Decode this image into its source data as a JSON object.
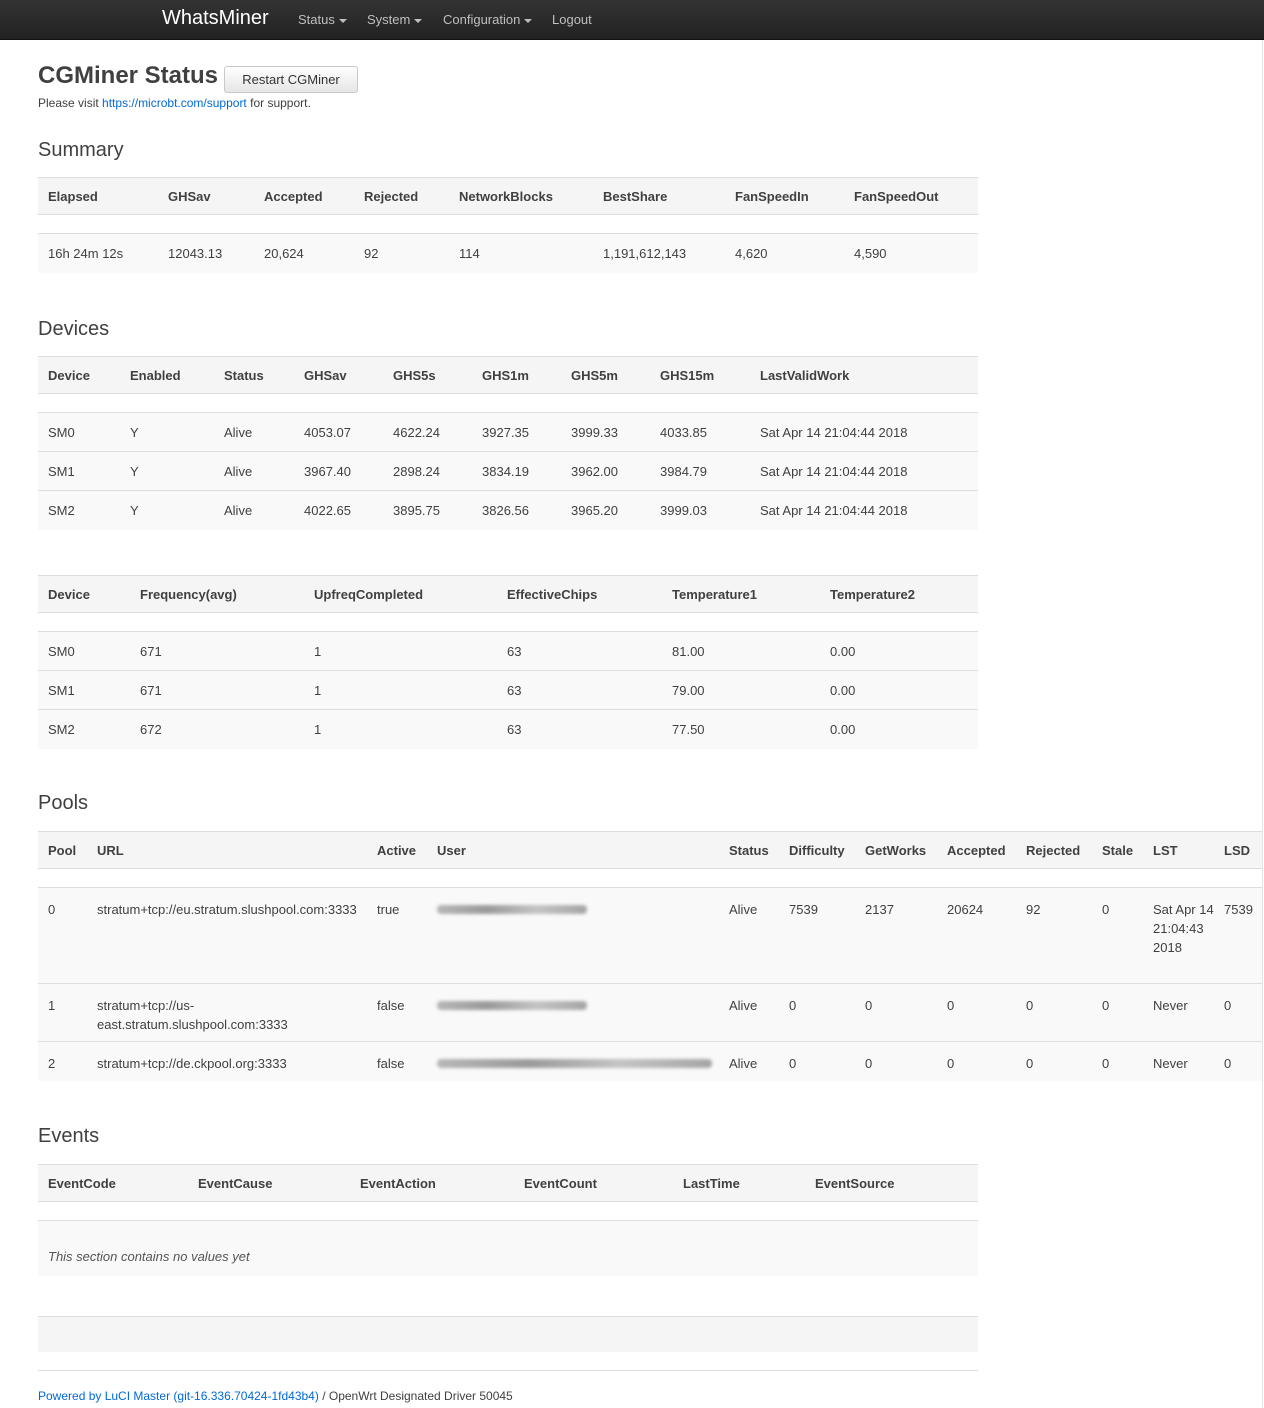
{
  "nav": {
    "brand": "WhatsMiner",
    "items": [
      {
        "label": "Status",
        "dropdown": true
      },
      {
        "label": "System",
        "dropdown": true
      },
      {
        "label": "Configuration",
        "dropdown": true
      },
      {
        "label": "Logout",
        "dropdown": false
      }
    ]
  },
  "header": {
    "title": "CGMiner Status",
    "restart_label": "Restart CGMiner",
    "support_prefix": "Please visit",
    "support_link": "https://microbt.com/support",
    "support_suffix": "for support."
  },
  "summary": {
    "title": "Summary",
    "columns": [
      "Elapsed",
      "GHSav",
      "Accepted",
      "Rejected",
      "NetworkBlocks",
      "BestShare",
      "FanSpeedIn",
      "FanSpeedOut"
    ],
    "rows": [
      [
        "16h 24m 12s",
        "12043.13",
        "20,624",
        "92",
        "114",
        "1,191,612,143",
        "4,620",
        "4,590"
      ]
    ]
  },
  "devices": {
    "title": "Devices",
    "columns": [
      "Device",
      "Enabled",
      "Status",
      "GHSav",
      "GHS5s",
      "GHS1m",
      "GHS5m",
      "GHS15m",
      "LastValidWork"
    ],
    "rows": [
      [
        "SM0",
        "Y",
        "Alive",
        "4053.07",
        "4622.24",
        "3927.35",
        "3999.33",
        "4033.85",
        "Sat Apr 14 21:04:44 2018"
      ],
      [
        "SM1",
        "Y",
        "Alive",
        "3967.40",
        "2898.24",
        "3834.19",
        "3962.00",
        "3984.79",
        "Sat Apr 14 21:04:44 2018"
      ],
      [
        "SM2",
        "Y",
        "Alive",
        "4022.65",
        "3895.75",
        "3826.56",
        "3965.20",
        "3999.03",
        "Sat Apr 14 21:04:44 2018"
      ]
    ]
  },
  "devices2": {
    "columns": [
      "Device",
      "Frequency(avg)",
      "UpfreqCompleted",
      "EffectiveChips",
      "Temperature1",
      "Temperature2"
    ],
    "rows": [
      [
        "SM0",
        "671",
        "1",
        "63",
        "81.00",
        "0.00"
      ],
      [
        "SM1",
        "671",
        "1",
        "63",
        "79.00",
        "0.00"
      ],
      [
        "SM2",
        "672",
        "1",
        "63",
        "77.50",
        "0.00"
      ]
    ]
  },
  "pools": {
    "title": "Pools",
    "columns": [
      "Pool",
      "URL",
      "Active",
      "User",
      "Status",
      "Difficulty",
      "GetWorks",
      "Accepted",
      "Rejected",
      "Stale",
      "LST",
      "LSD"
    ],
    "rows": [
      [
        "0",
        "stratum+tcp://eu.stratum.slushpool.com:3333",
        "true",
        "",
        "Alive",
        "7539",
        "2137",
        "20624",
        "92",
        "0",
        "Sat Apr 14 21:04:43 2018",
        "7539"
      ],
      [
        "1",
        "stratum+tcp://us-east.stratum.slushpool.com:3333",
        "false",
        "",
        "Alive",
        "0",
        "0",
        "0",
        "0",
        "0",
        "Never",
        "0"
      ],
      [
        "2",
        "stratum+tcp://de.ckpool.org:3333",
        "false",
        "",
        "Alive",
        "0",
        "0",
        "0",
        "0",
        "0",
        "Never",
        "0"
      ]
    ]
  },
  "events": {
    "title": "Events",
    "columns": [
      "EventCode",
      "EventCause",
      "EventAction",
      "EventCount",
      "LastTime",
      "EventSource"
    ],
    "empty_text": "This section contains no values yet"
  },
  "footer": {
    "powered": "Powered by LuCI Master (git-16.336.70424-1fd43b4)",
    "rest": "/ OpenWrt Designated Driver 50045"
  }
}
